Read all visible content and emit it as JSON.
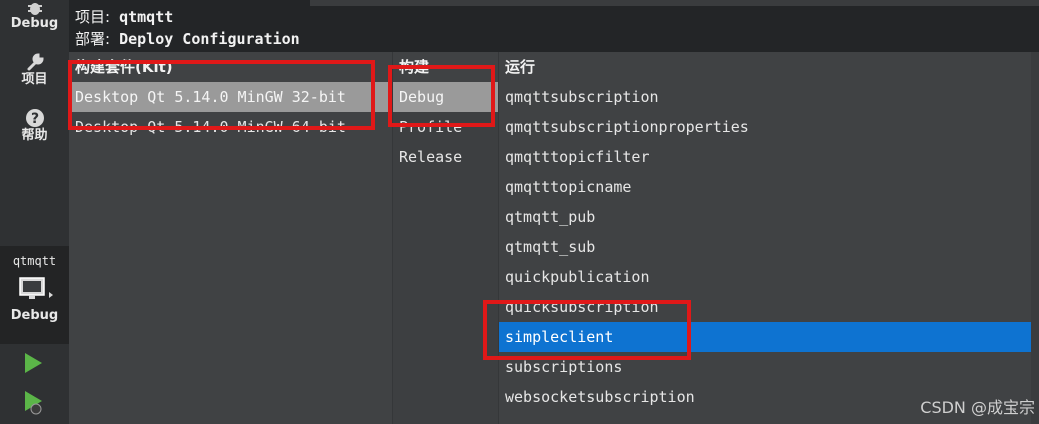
{
  "sidebar": {
    "top_mode": {
      "label": "Debug",
      "icon": "bug-icon"
    },
    "project_mode": {
      "label": "项目",
      "icon": "wrench-icon"
    },
    "help_mode": {
      "label": "帮助",
      "icon": "help-icon"
    },
    "target": {
      "project": "qtmqtt",
      "icon": "monitor-icon",
      "build": "Debug"
    },
    "run_icon": "run-icon",
    "debug_run_icon": "debug-run-icon"
  },
  "header": {
    "project_key": "项目:",
    "project_value": "qtmqtt",
    "deploy_key": "部署:",
    "deploy_value": "Deploy Configuration"
  },
  "columns": {
    "kit_header": "构建套件(Kit)",
    "build_header": "构建",
    "run_header": "运行"
  },
  "kits": [
    "Desktop Qt 5.14.0 MinGW 32-bit",
    "Desktop Qt 5.14.0 MinGW 64-bit"
  ],
  "builds": [
    "Debug",
    "Profile",
    "Release"
  ],
  "runs": [
    "qmqttsubscription",
    "qmqttsubscriptionproperties",
    "qmqtttopicfilter",
    "qmqtttopicname",
    "qtmqtt_pub",
    "qtmqtt_sub",
    "quickpublication",
    "quicksubscription",
    "simpleclient",
    "subscriptions",
    "websocketsubscription"
  ],
  "selected": {
    "kit": "Desktop Qt 5.14.0 MinGW 32-bit",
    "build": "Debug",
    "run": "simpleclient"
  },
  "colors": {
    "selection_blue": "#0e73d1",
    "selection_grey": "#9a9a9a",
    "annotation_red": "#e01818"
  },
  "watermark": "CSDN @成宝宗"
}
